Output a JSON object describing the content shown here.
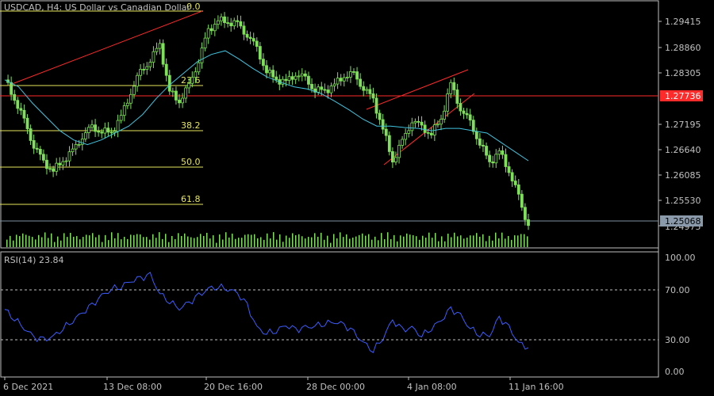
{
  "header": {
    "title": "USDCAD, H4:  US Dollar vs Canadian Dollar"
  },
  "price_axis": {
    "ticks": [
      "1.29415",
      "1.28860",
      "1.28305",
      "1.27195",
      "1.26640",
      "1.26085",
      "1.25530",
      "1.24975"
    ],
    "marker_red": "1.27736",
    "marker_current": "1.25068"
  },
  "fibonacci": {
    "levels": [
      "0.0",
      "23.6",
      "38.2",
      "50.0",
      "61.8"
    ]
  },
  "rsi": {
    "label": "RSI(14) 23.84",
    "ticks": [
      "100.00",
      "70.00",
      "30.00",
      "0.00"
    ]
  },
  "time_axis": {
    "labels": [
      "6 Dec 2021",
      "13 Dec 08:00",
      "20 Dec 16:00",
      "28 Dec 00:00",
      "4 Jan 08:00",
      "11 Jan 16:00"
    ]
  },
  "colors": {
    "background": "#000000",
    "candle": "#7fe05a",
    "ma": "#40c4e0",
    "fib": "#e6e65a",
    "trend": "#ff2a2a",
    "rsi": "#3c5cff",
    "axis": "#c0c0c0"
  },
  "chart_data": {
    "type": "line",
    "series": [
      {
        "values": [
          1.2815,
          1.2775,
          1.2725,
          1.2675,
          1.2635,
          1.262,
          1.264,
          1.266,
          1.2695,
          1.271,
          1.2705,
          1.27,
          1.2735,
          1.279,
          1.283,
          1.286,
          1.289,
          1.279,
          1.277,
          1.28,
          1.286,
          1.292,
          1.2945,
          1.294,
          1.2935,
          1.2915,
          1.288,
          1.2835,
          1.2815,
          1.281,
          1.283,
          1.2815,
          1.2795,
          1.279,
          1.2805,
          1.2825,
          1.2825,
          1.28,
          1.277,
          1.271,
          1.264,
          1.268,
          1.273,
          1.271,
          1.27,
          1.273,
          1.2805,
          1.2755,
          1.272,
          1.268,
          1.2635,
          1.266,
          1.262,
          1.256,
          1.25
        ]
      },
      {
        "values": [
          1.2815,
          1.28,
          1.2765,
          1.2735,
          1.2705,
          1.2685,
          1.2675,
          1.2685,
          1.27,
          1.2715,
          1.274,
          1.2775,
          1.2805,
          1.283,
          1.2855,
          1.287,
          1.2878,
          1.286,
          1.284,
          1.2822,
          1.281,
          1.28,
          1.2795,
          1.2785,
          1.2768,
          1.275,
          1.273,
          1.2715,
          1.2715,
          1.2712,
          1.271,
          1.2705,
          1.271,
          1.271,
          1.2705,
          1.27,
          1.268,
          1.266,
          1.264
        ]
      },
      {
        "values": [
          55,
          48,
          40,
          32,
          30,
          33,
          40,
          46,
          52,
          58,
          66,
          72,
          74,
          78,
          80,
          83,
          68,
          62,
          56,
          60,
          66,
          72,
          74,
          72,
          68,
          58,
          40,
          36,
          38,
          42,
          38,
          40,
          42,
          44,
          45,
          42,
          36,
          28,
          22,
          32,
          46,
          38,
          40,
          34,
          40,
          46,
          55,
          50,
          40,
          35,
          34,
          48,
          40,
          28,
          23.84
        ]
      }
    ]
  }
}
